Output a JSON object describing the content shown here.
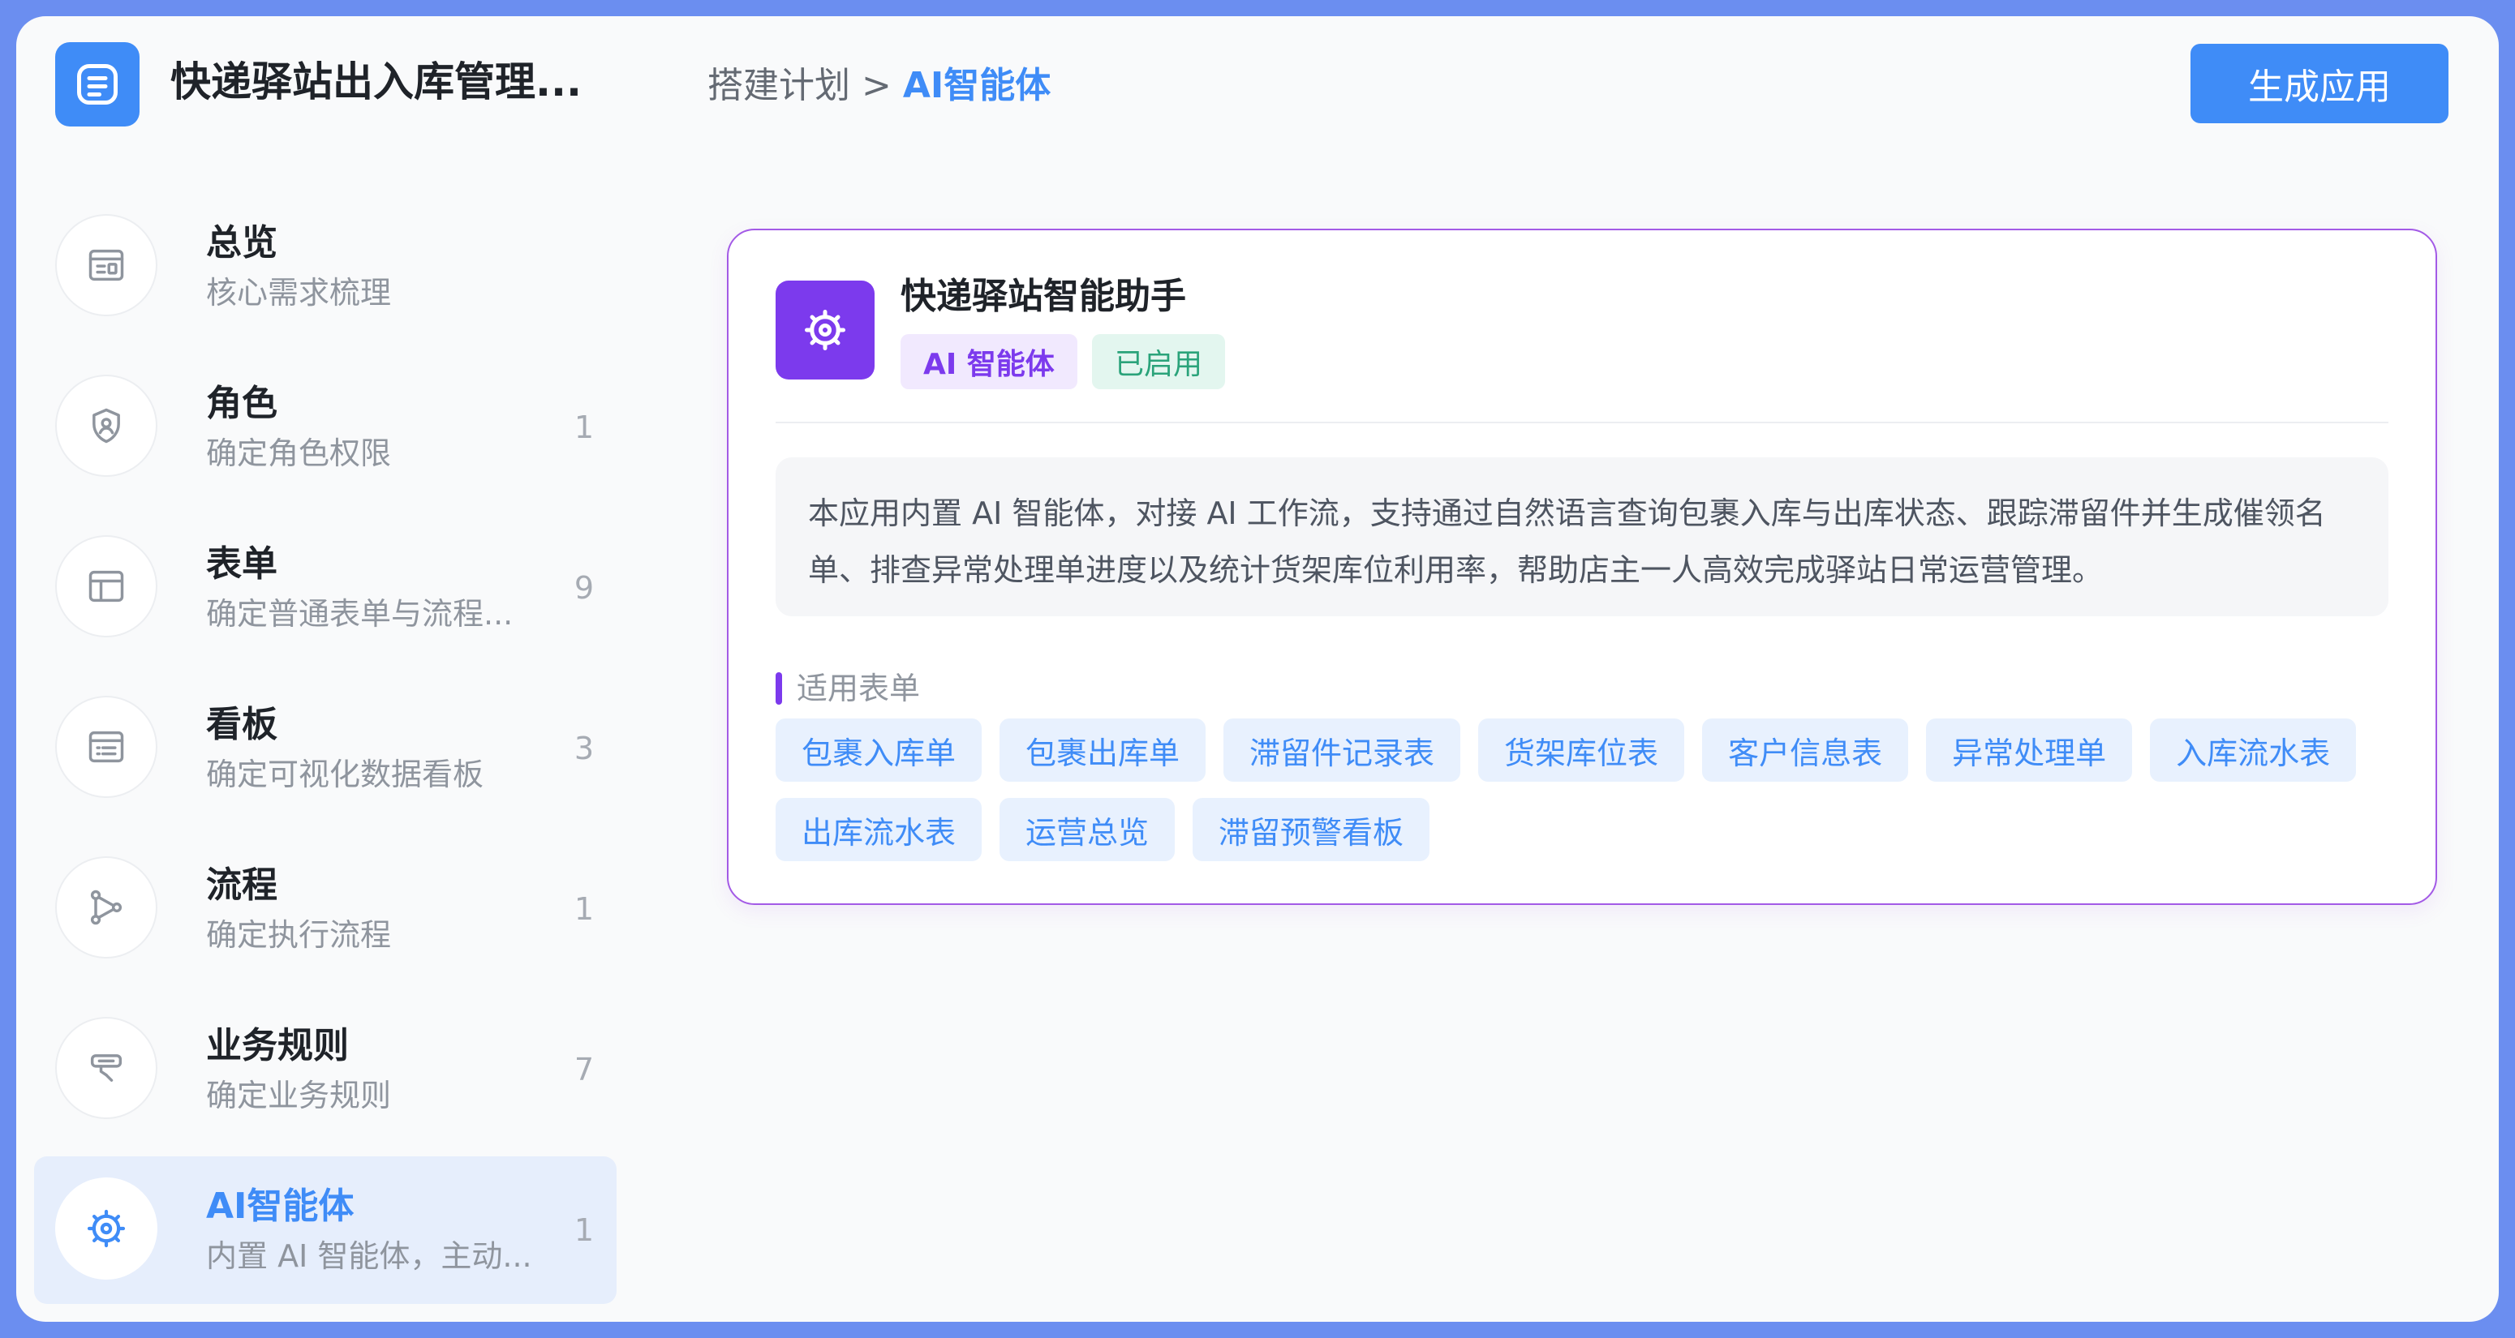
{
  "header": {
    "app_title": "快递驿站出入库管理...",
    "breadcrumb": [
      "搭建计划",
      ">",
      "AI智能体"
    ],
    "generate_button": "生成应用"
  },
  "sidebar": {
    "items": [
      {
        "title": "总览",
        "desc": "核心需求梳理",
        "count": "",
        "icon": "overview-icon"
      },
      {
        "title": "角色",
        "desc": "确定角色权限",
        "count": "1",
        "icon": "shield-user-icon"
      },
      {
        "title": "表单",
        "desc": "确定普通表单与流程...",
        "count": "9",
        "icon": "table-icon"
      },
      {
        "title": "看板",
        "desc": "确定可视化数据看板",
        "count": "3",
        "icon": "dashboard-icon"
      },
      {
        "title": "流程",
        "desc": "确定执行流程",
        "count": "1",
        "icon": "flow-icon"
      },
      {
        "title": "业务规则",
        "desc": "确定业务规则",
        "count": "7",
        "icon": "rule-icon"
      },
      {
        "title": "AI智能体",
        "desc": "内置 AI 智能体，主动...",
        "count": "1",
        "icon": "ai-agent-icon",
        "active": true
      }
    ]
  },
  "card": {
    "name": "快递驿站智能助手",
    "badge_type": "AI 智能体",
    "badge_status": "已启用",
    "description": "本应用内置 AI 智能体，对接 AI 工作流，支持通过自然语言查询包裹入库与出库状态、跟踪滞留件并生成催领名单、排查异常处理单进度以及统计货架库位利用率，帮助店主一人高效完成驿站日常运营管理。",
    "section_label": "适用表单",
    "forms": [
      "包裹入库单",
      "包裹出库单",
      "滞留件记录表",
      "货架库位表",
      "客户信息表",
      "异常处理单",
      "入库流水表",
      "出库流水表",
      "运营总览",
      "滞留预警看板"
    ]
  },
  "colors": {
    "primary": "#3f8cf7",
    "ai_purple": "#7c3aed",
    "status_green": "#2aa37a",
    "frame_border": "#6b8ef0"
  }
}
